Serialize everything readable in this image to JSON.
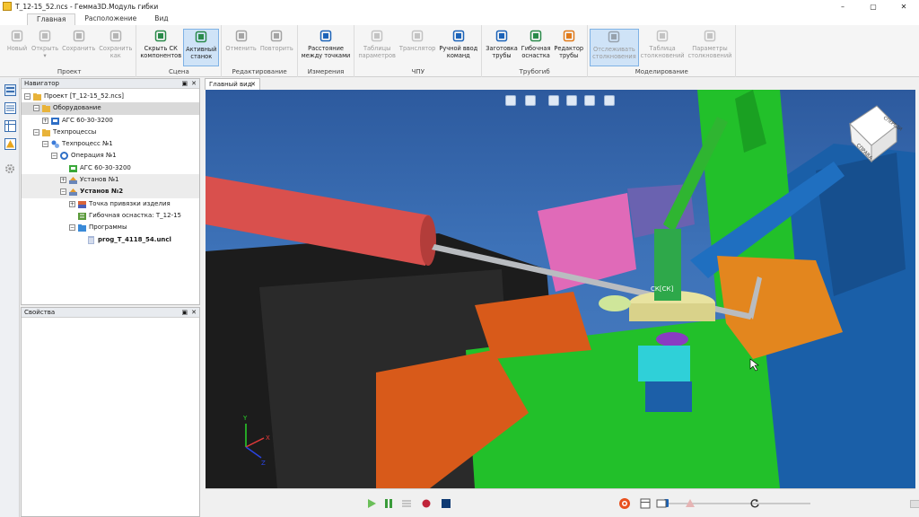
{
  "window": {
    "title": "T_12-15_52.ncs - Гемма3D.Модуль гибки",
    "controls": [
      "–",
      "▢",
      "✕"
    ]
  },
  "menu_tabs": [
    "Главная",
    "Расположение",
    "Вид"
  ],
  "ribbon": {
    "groups": [
      {
        "label": "Проект",
        "buttons": [
          {
            "label": "Новый",
            "icon": "new-project-icon",
            "enabled": false
          },
          {
            "label": "Открыть\n▾",
            "icon": "open-icon",
            "enabled": false
          },
          {
            "label": "Сохранить",
            "icon": "save-icon",
            "enabled": false
          },
          {
            "label": "Сохранить\nкак",
            "icon": "save-as-icon",
            "enabled": false
          }
        ]
      },
      {
        "label": "Сцена",
        "buttons": [
          {
            "label": "Скрыть СК\nкомпонентов",
            "icon": "hide-axes-icon",
            "enabled": true
          },
          {
            "label": "Активный\nстанок",
            "icon": "active-machine-icon",
            "enabled": true,
            "selected": true
          }
        ]
      },
      {
        "label": "Редактирование",
        "buttons": [
          {
            "label": "Отменить",
            "icon": "undo-icon",
            "enabled": false
          },
          {
            "label": "Повторить",
            "icon": "redo-icon",
            "enabled": false
          }
        ]
      },
      {
        "label": "Измерения",
        "buttons": [
          {
            "label": "Расстояние\nмежду точками",
            "icon": "measure-distance-icon",
            "enabled": true
          }
        ]
      },
      {
        "label": "ЧПУ",
        "buttons": [
          {
            "label": "Таблицы\nпараметров",
            "icon": "parameter-tables-icon",
            "enabled": false
          },
          {
            "label": "Транслятор",
            "icon": "translator-icon",
            "enabled": false
          },
          {
            "label": "Ручной ввод\nкоманд",
            "icon": "manual-input-icon",
            "enabled": true
          }
        ]
      },
      {
        "label": "Трубогиб",
        "buttons": [
          {
            "label": "Заготовка\nтрубы",
            "icon": "tube-blank-icon",
            "enabled": true
          },
          {
            "label": "Гибочная\nоснастка",
            "icon": "bending-tooling-icon",
            "enabled": true
          },
          {
            "label": "Редактор\nтрубы",
            "icon": "tube-editor-icon",
            "enabled": true
          }
        ]
      },
      {
        "label": "Моделирование",
        "buttons": [
          {
            "label": "Отслеживать\nстолкновения",
            "icon": "track-collisions-icon",
            "enabled": false,
            "selected": true
          },
          {
            "label": "Таблица\nстолкновений",
            "icon": "collision-table-icon",
            "enabled": false
          },
          {
            "label": "Параметры\nстолкновений",
            "icon": "collision-params-icon",
            "enabled": false
          }
        ]
      }
    ]
  },
  "navigator": {
    "title": "Навигатор",
    "items": [
      {
        "label": "Проект [T_12-15_52.ncs]",
        "level": 0,
        "icon": "folder-icon",
        "expander": "⊟"
      },
      {
        "label": "Оборудование",
        "level": 1,
        "icon": "folder-icon",
        "expander": "⊟",
        "highlight": "selected"
      },
      {
        "label": "АГС 60-30-3200",
        "level": 2,
        "icon": "machine-icon",
        "expander": "⊞"
      },
      {
        "label": "Техпроцессы",
        "level": 1,
        "icon": "folder-icon",
        "expander": "⊟"
      },
      {
        "label": "Техпроцесс №1",
        "level": 2,
        "icon": "process-icon",
        "expander": "⊟"
      },
      {
        "label": "Операция №1",
        "level": 3,
        "icon": "gear-icon",
        "expander": "⊟"
      },
      {
        "label": "АГС 60-30-3200",
        "level": 4,
        "icon": "machine-green-icon",
        "expander": ""
      },
      {
        "label": "Установ №1",
        "level": 4,
        "icon": "setup-icon",
        "expander": "⊞",
        "highlight": "hover"
      },
      {
        "label": "Установ №2",
        "level": 4,
        "icon": "setup-icon",
        "expander": "⊟",
        "bold": true,
        "highlight": "hover"
      },
      {
        "label": "Точка привязки изделия",
        "level": 5,
        "icon": "anchor-point-icon",
        "expander": "⊞"
      },
      {
        "label": "Гибочная оснастка: T_12-15",
        "level": 5,
        "icon": "tooling-icon",
        "expander": ""
      },
      {
        "label": "Программы",
        "level": 5,
        "icon": "folder-blue-icon",
        "expander": "⊟"
      },
      {
        "label": "prog_T_4118_54.uncl",
        "level": 6,
        "icon": "program-file-icon",
        "expander": "",
        "bold": true
      }
    ]
  },
  "properties": {
    "title": "Свойства"
  },
  "panel_buttons": [
    "▣",
    "✕"
  ],
  "viewport": {
    "tab_label": "Главный вид",
    "tab_close": "✕",
    "viewcube_label": "СПРАВА",
    "viewcube_top": "СПЕРЕДИ",
    "tool_label": "СК[СК]",
    "axes": {
      "x": "X",
      "y": "Y",
      "z": "Z"
    },
    "toolbar_icons": [
      "rotate-left-icon",
      "rotate-right-icon",
      "fit-icon",
      "palette-icon",
      "eye-icon",
      "render-mode-icon"
    ]
  },
  "playback": {
    "icons": [
      "play-icon",
      "pause-icon",
      "step-list-icon",
      "record-icon",
      "stop-icon",
      "target-icon",
      "table-icon",
      "settings-icon",
      "collision-warning-icon",
      "reset-icon"
    ]
  },
  "colors": {
    "accent": "#1c63b8",
    "viewport_bg": "#3d72b8",
    "machine_green": "#22c02a",
    "machine_orange": "#d85a1a",
    "machine_blue": "#1a5fa8",
    "machine_pink": "#e06ab8",
    "tube_red": "#d9504d"
  }
}
